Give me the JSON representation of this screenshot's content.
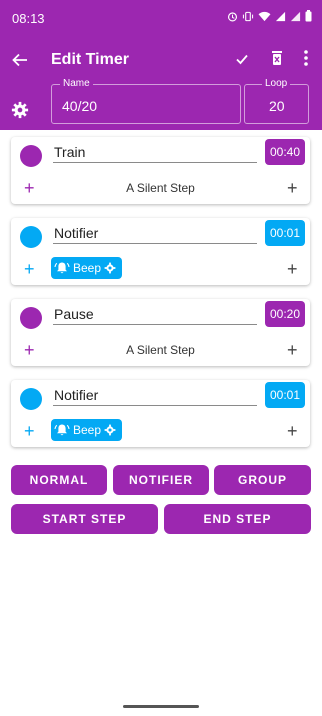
{
  "status": {
    "time": "08:13"
  },
  "appbar": {
    "title": "Edit Timer",
    "name_label": "Name",
    "name_value": "40/20",
    "loop_label": "Loop",
    "loop_value": "20"
  },
  "colors": {
    "purple": "#9c27b0",
    "blue": "#03a9f4"
  },
  "steps": [
    {
      "name": "Train",
      "time": "00:40",
      "type": "silent",
      "info": "A Silent Step",
      "color": "#9c27b0"
    },
    {
      "name": "Notifier",
      "time": "00:01",
      "type": "notifier",
      "info": "Beep",
      "color": "#03a9f4"
    },
    {
      "name": "Pause",
      "time": "00:20",
      "type": "silent",
      "info": "A Silent Step",
      "color": "#9c27b0"
    },
    {
      "name": "Notifier",
      "time": "00:01",
      "type": "notifier",
      "info": "Beep",
      "color": "#03a9f4"
    }
  ],
  "buttons": {
    "normal": "NORMAL",
    "notifier": "NOTIFIER",
    "group": "GROUP",
    "start_step": "START STEP",
    "end_step": "END STEP"
  },
  "icons": [
    "back-arrow-icon",
    "check-icon",
    "delete-icon",
    "more-vert-icon",
    "gear-icon",
    "plus-icon",
    "bell-icon"
  ]
}
